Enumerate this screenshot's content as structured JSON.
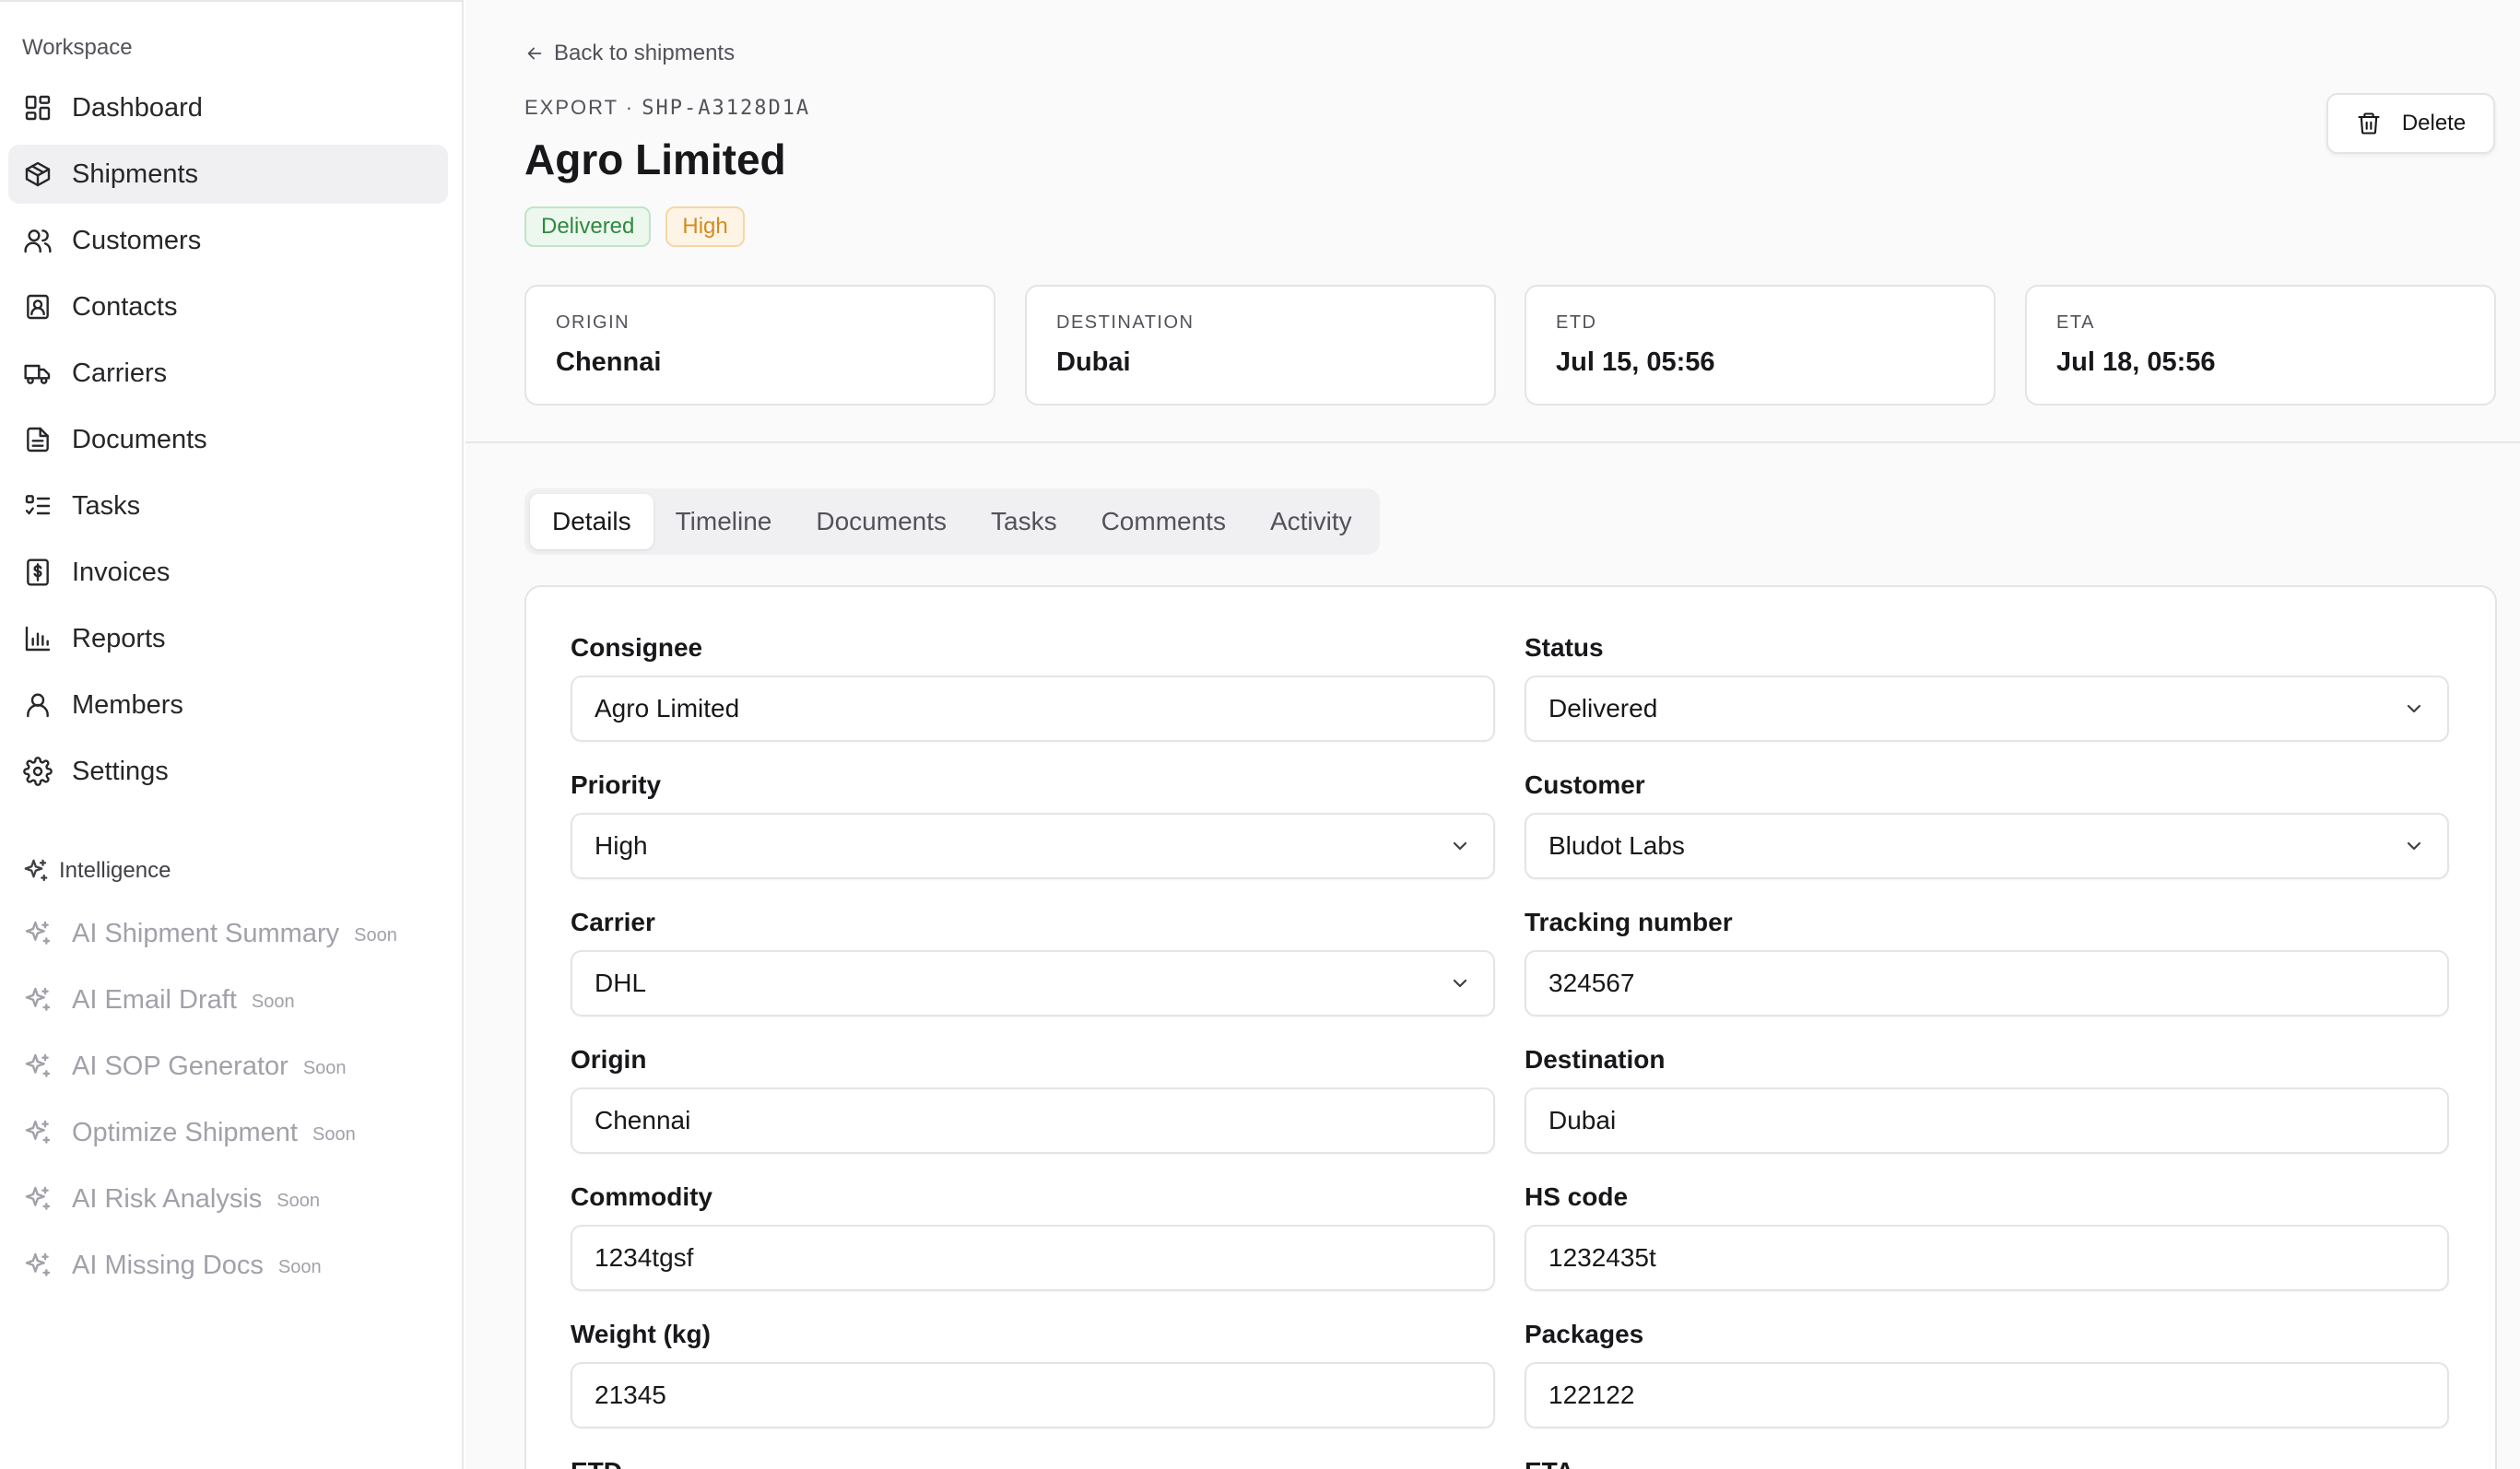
{
  "sidebar": {
    "workspace_label": "Workspace",
    "nav": [
      {
        "label": "Dashboard",
        "icon": "dashboard-icon"
      },
      {
        "label": "Shipments",
        "icon": "package-icon",
        "active": true
      },
      {
        "label": "Customers",
        "icon": "users-icon"
      },
      {
        "label": "Contacts",
        "icon": "contact-book-icon"
      },
      {
        "label": "Carriers",
        "icon": "truck-icon"
      },
      {
        "label": "Documents",
        "icon": "document-icon"
      },
      {
        "label": "Tasks",
        "icon": "checklist-icon"
      },
      {
        "label": "Invoices",
        "icon": "dollar-receipt-icon"
      },
      {
        "label": "Reports",
        "icon": "bar-chart-icon"
      },
      {
        "label": "Members",
        "icon": "user-icon"
      },
      {
        "label": "Settings",
        "icon": "gear-icon"
      }
    ],
    "intelligence_label": "Intelligence",
    "ai_items": [
      {
        "label": "AI Shipment Summary",
        "badge": "Soon"
      },
      {
        "label": "AI Email Draft",
        "badge": "Soon"
      },
      {
        "label": "AI SOP Generator",
        "badge": "Soon"
      },
      {
        "label": "Optimize Shipment",
        "badge": "Soon"
      },
      {
        "label": "AI Risk Analysis",
        "badge": "Soon"
      },
      {
        "label": "AI Missing Docs",
        "badge": "Soon"
      }
    ]
  },
  "header": {
    "back_label": "Back to shipments",
    "eyebrow_type": "EXPORT ·",
    "eyebrow_id": "SHP-A3128D1A",
    "title": "Agro Limited",
    "badges": {
      "status": "Delivered",
      "priority": "High"
    },
    "delete_label": "Delete"
  },
  "stats": [
    {
      "label": "ORIGIN",
      "value": "Chennai"
    },
    {
      "label": "DESTINATION",
      "value": "Dubai"
    },
    {
      "label": "ETD",
      "value": "Jul 15, 05:56"
    },
    {
      "label": "ETA",
      "value": "Jul 18, 05:56"
    }
  ],
  "tabs": [
    "Details",
    "Timeline",
    "Documents",
    "Tasks",
    "Comments",
    "Activity"
  ],
  "active_tab": "Details",
  "form": {
    "consignee": {
      "label": "Consignee",
      "value": "Agro Limited"
    },
    "status": {
      "label": "Status",
      "value": "Delivered"
    },
    "priority": {
      "label": "Priority",
      "value": "High"
    },
    "customer": {
      "label": "Customer",
      "value": "Bludot Labs"
    },
    "carrier": {
      "label": "Carrier",
      "value": "DHL"
    },
    "tracking": {
      "label": "Tracking number",
      "value": "324567"
    },
    "origin": {
      "label": "Origin",
      "value": "Chennai"
    },
    "destination": {
      "label": "Destination",
      "value": "Dubai"
    },
    "commodity": {
      "label": "Commodity",
      "value": "1234tgsf"
    },
    "hs_code": {
      "label": "HS code",
      "value": "1232435t"
    },
    "weight": {
      "label": "Weight (kg)",
      "value": "21345"
    },
    "packages": {
      "label": "Packages",
      "value": "122122"
    },
    "etd": {
      "label": "ETD",
      "value": ""
    },
    "eta": {
      "label": "ETA",
      "value": ""
    }
  },
  "colors": {
    "accent_active_bg": "#f0f0f2",
    "delivered_green": "#2f8a3f",
    "high_amber": "#d48b1f",
    "border": "#e4e4e7"
  }
}
